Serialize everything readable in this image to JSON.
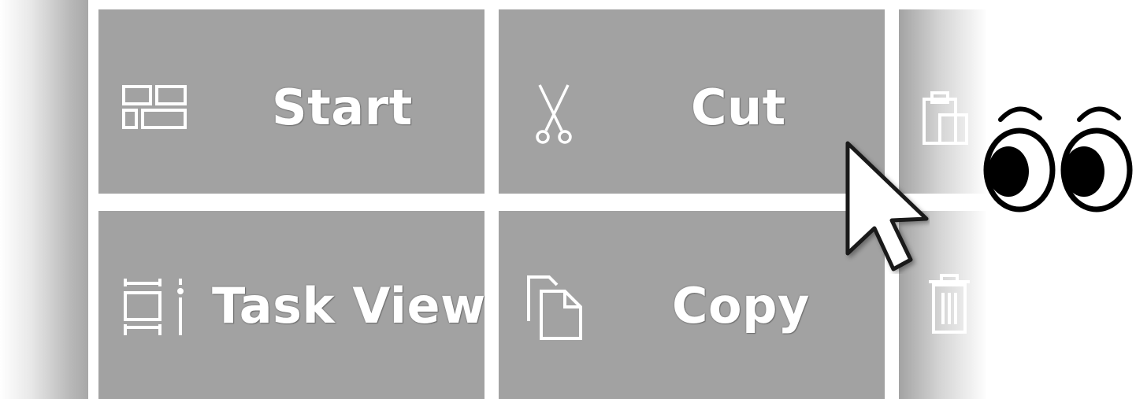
{
  "tiles": {
    "start": {
      "label": "Start",
      "icon": "start-grid-icon"
    },
    "cut": {
      "label": "Cut",
      "icon": "scissors-icon"
    },
    "taskview": {
      "label": "Task View",
      "icon": "task-view-icon"
    },
    "copy": {
      "label": "Copy",
      "icon": "copy-icon"
    },
    "paste": {
      "label": "",
      "icon": "paste-icon"
    },
    "delete": {
      "label": "",
      "icon": "trash-icon"
    }
  },
  "decorations": {
    "pointer": "mouse-pointer-icon",
    "eyes": "eyes-emoji"
  },
  "colors": {
    "tile_background": "#a2a2a2",
    "tile_text": "#ffffff",
    "panel_gap": "#ffffff"
  }
}
